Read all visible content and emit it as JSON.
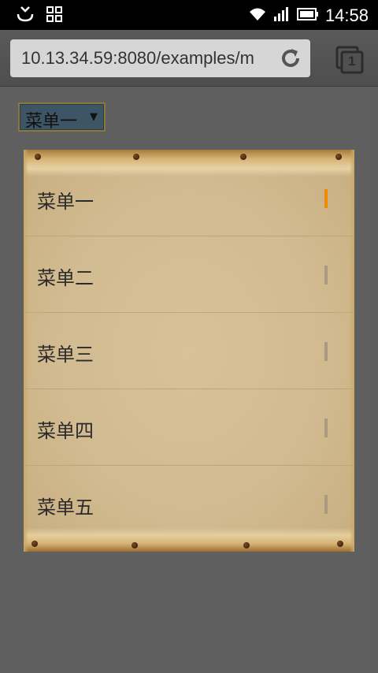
{
  "status_bar": {
    "time": "14:58",
    "icons": [
      "download-icon",
      "grid-icon",
      "wifi-icon",
      "signal-icon",
      "battery-icon"
    ]
  },
  "browser": {
    "url": "10.13.34.59:8080/examples/m",
    "tab_count": "1"
  },
  "select": {
    "selected": "菜单一"
  },
  "menu": {
    "items": [
      {
        "label": "菜单一",
        "active": true
      },
      {
        "label": "菜单二",
        "active": false
      },
      {
        "label": "菜单三",
        "active": false
      },
      {
        "label": "菜单四",
        "active": false
      },
      {
        "label": "菜单五",
        "active": false
      }
    ],
    "active_color": "#f08a00",
    "inactive_color": "#a99a80"
  }
}
